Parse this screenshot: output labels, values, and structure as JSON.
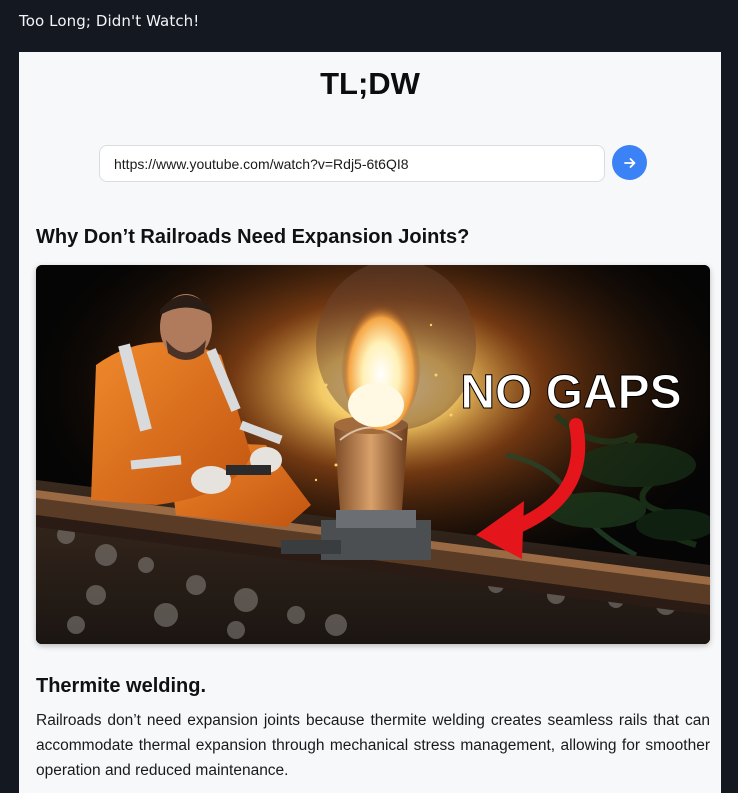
{
  "window": {
    "title": "Too Long; Didn't Watch!"
  },
  "app": {
    "title": "TL;DW"
  },
  "url_form": {
    "value": "https://www.youtube.com/watch?v=Rdj5-6t6QI8",
    "submit_icon": "arrow-right-icon",
    "accent_color": "#3b82f6"
  },
  "video": {
    "title": "Why Don’t Railroads Need Expansion Joints?",
    "thumbnail": {
      "overlay_text": "NO GAPS"
    }
  },
  "summary": {
    "heading": "Thermite welding.",
    "body": "Railroads don’t need expansion joints because thermite welding creates seamless rails that can accommodate thermal expansion through mechanical stress management, allowing for smoother operation and reduced maintenance."
  }
}
